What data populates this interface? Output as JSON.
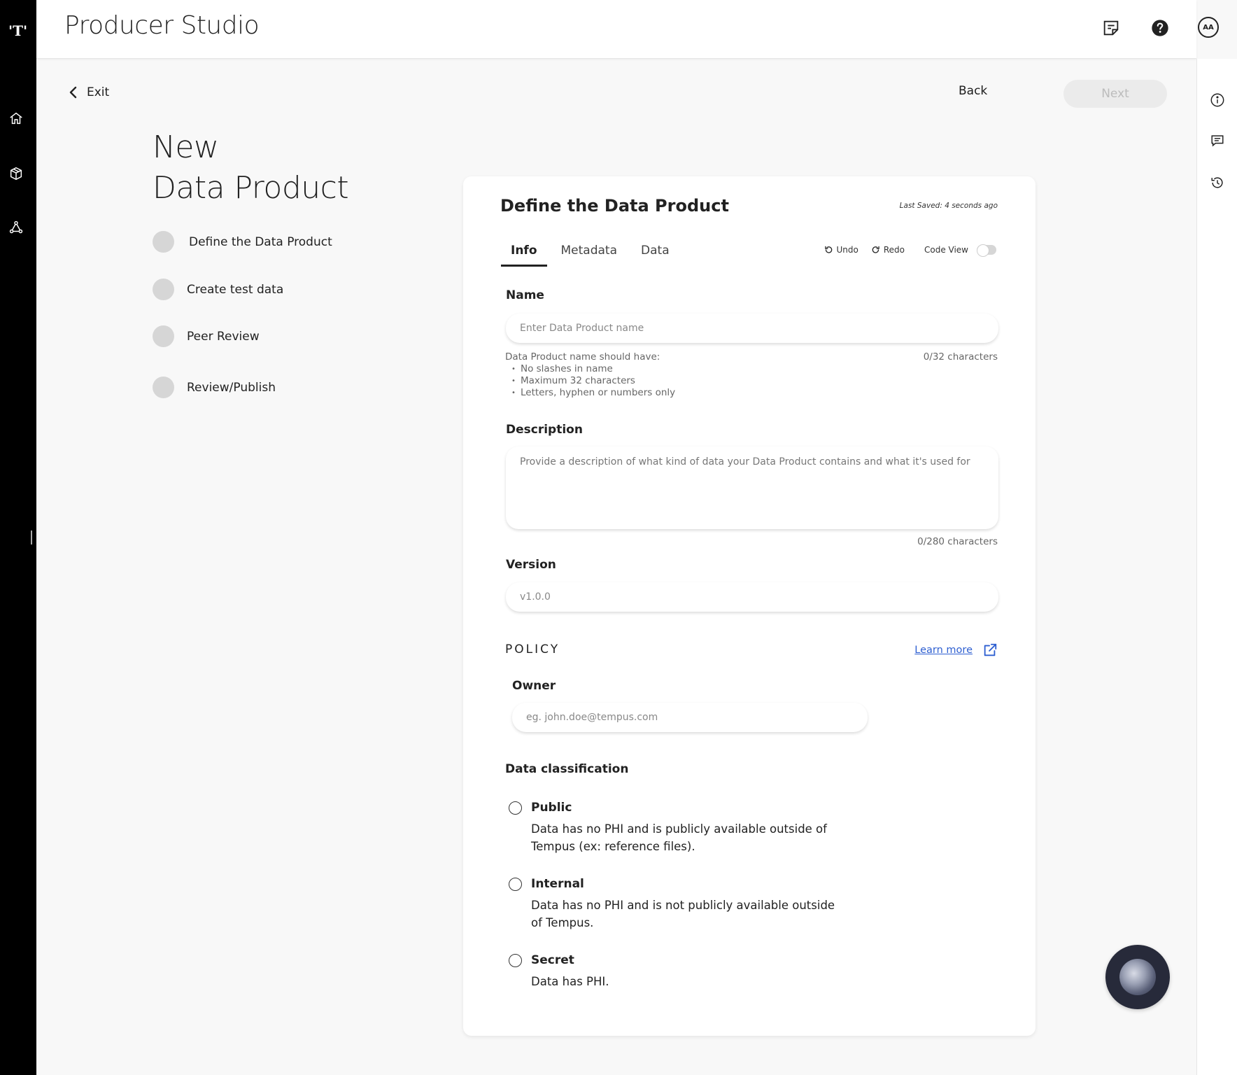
{
  "app": {
    "logo": "'T'",
    "title": "Producer Studio",
    "avatar_initials": "AA"
  },
  "nav": {
    "icons": [
      "home-icon",
      "package-icon",
      "network-icon"
    ]
  },
  "header_icons": [
    "notes-icon",
    "help-icon"
  ],
  "right_rail_icons": [
    "info-icon",
    "comment-icon",
    "history-icon"
  ],
  "top_actions": {
    "exit_label": "Exit",
    "back_label": "Back",
    "next_label": "Next"
  },
  "page": {
    "title_line1": "New",
    "title_line2": "Data Product"
  },
  "steps": [
    {
      "label": "Define the Data Product"
    },
    {
      "label": "Create test data"
    },
    {
      "label": "Peer Review"
    },
    {
      "label": "Review/Publish"
    }
  ],
  "card": {
    "title": "Define the Data Product",
    "last_saved": "Last Saved: 4 seconds ago",
    "tabs": [
      {
        "label": "Info",
        "active": true
      },
      {
        "label": "Metadata",
        "active": false
      },
      {
        "label": "Data",
        "active": false
      }
    ],
    "tools": {
      "undo_label": "Undo",
      "redo_label": "Redo",
      "code_view_label": "Code View",
      "code_view_enabled": false
    }
  },
  "form": {
    "name": {
      "label": "Name",
      "placeholder": "Enter Data Product name",
      "value": "",
      "hint_title": "Data Product name should have:",
      "hint_items": [
        "No slashes in name",
        "Maximum 32 characters",
        "Letters, hyphen or numbers only"
      ],
      "counter": "0/32 characters"
    },
    "description": {
      "label": "Description",
      "placeholder": "Provide a description of what kind of data your Data Product contains and what it's used for",
      "value": "",
      "counter": "0/280 characters"
    },
    "version": {
      "label": "Version",
      "placeholder": "v1.0.0",
      "value": ""
    }
  },
  "policy": {
    "heading": "POLICY",
    "learn_more": "Learn more",
    "owner": {
      "label": "Owner",
      "placeholder": "eg. john.doe@tempus.com",
      "value": ""
    },
    "classification": {
      "label": "Data classification",
      "options": [
        {
          "title": "Public",
          "description": "Data has no PHI and is publicly available outside of Tempus (ex: reference files).",
          "selected": false
        },
        {
          "title": "Internal",
          "description": "Data has no PHI and is not publicly available outside of Tempus.",
          "selected": false
        },
        {
          "title": "Secret",
          "description": "Data has PHI.",
          "selected": false
        }
      ]
    }
  },
  "colors": {
    "nav_bg": "#000000",
    "link": "#2e5fd1",
    "disabled_button_bg": "#ebebeb",
    "fab_bg": "#272a3a"
  }
}
